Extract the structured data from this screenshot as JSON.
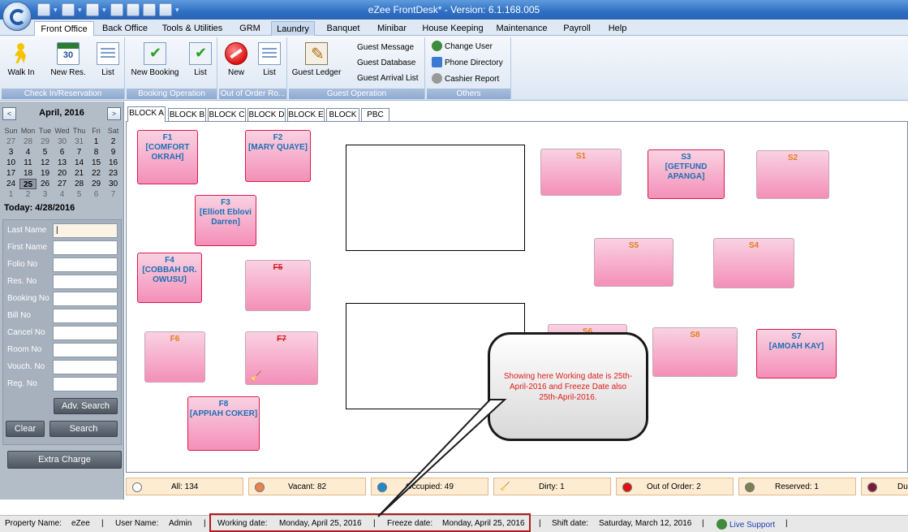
{
  "window": {
    "title": "eZee FrontDesk* - Version: 6.1.168.005"
  },
  "ribbon_tabs": [
    {
      "label": "Front Office"
    },
    {
      "label": "Back Office"
    },
    {
      "label": "Tools & Utilities"
    },
    {
      "label": "GRM"
    },
    {
      "label": "Laundry"
    },
    {
      "label": "Banquet"
    },
    {
      "label": "Minibar"
    },
    {
      "label": "House Keeping"
    },
    {
      "label": "Maintenance"
    },
    {
      "label": "Payroll"
    },
    {
      "label": "Help"
    }
  ],
  "ribbon": {
    "checkin": {
      "label": "Check In/Reservation",
      "walk_in": "Walk In",
      "new_res": "New Res.",
      "list": "List",
      "cal_day": "30"
    },
    "booking": {
      "label": "Booking Operation",
      "new_booking": "New Booking",
      "list": "List"
    },
    "ooo": {
      "label": "Out of Order Ro...",
      "new": "New",
      "list": "List"
    },
    "guest": {
      "label": "Guest Operation",
      "guest_ledger": "Guest Ledger",
      "guest_message": "Guest Message",
      "guest_database": "Guest Database",
      "guest_arrival_list": "Guest Arrival List"
    },
    "others": {
      "label": "Others",
      "change_user": "Change User",
      "phone_directory": "Phone Directory",
      "cashier_report": "Cashier Report"
    }
  },
  "calendar": {
    "prev": "<",
    "next": ">",
    "title": "April, 2016",
    "weekdays": [
      "Sun",
      "Mon",
      "Tue",
      "Wed",
      "Thu",
      "Fri",
      "Sat"
    ],
    "weeks": [
      [
        "27",
        "28",
        "29",
        "30",
        "31",
        "1",
        "2"
      ],
      [
        "3",
        "4",
        "5",
        "6",
        "7",
        "8",
        "9"
      ],
      [
        "10",
        "11",
        "12",
        "13",
        "14",
        "15",
        "16"
      ],
      [
        "17",
        "18",
        "19",
        "20",
        "21",
        "22",
        "23"
      ],
      [
        "24",
        "25",
        "26",
        "27",
        "28",
        "29",
        "30"
      ],
      [
        "1",
        "2",
        "3",
        "4",
        "5",
        "6",
        "7"
      ]
    ],
    "selected": "25",
    "today": "Today: 4/28/2016"
  },
  "search": {
    "fields": [
      {
        "label": "Last Name"
      },
      {
        "label": "First Name"
      },
      {
        "label": "Folio No"
      },
      {
        "label": "Res. No"
      },
      {
        "label": "Booking No"
      },
      {
        "label": "Bill No"
      },
      {
        "label": "Cancel No"
      },
      {
        "label": "Room No"
      },
      {
        "label": "Vouch. No"
      },
      {
        "label": "Reg. No"
      }
    ],
    "adv_search": "Adv. Search",
    "clear": "Clear",
    "search": "Search",
    "extra_charge": "Extra Charge"
  },
  "block_tabs": [
    "BLOCK A",
    "BLOCK B",
    "BLOCK C",
    "BLOCK D",
    "BLOCK E",
    "BLOCK F",
    "PBC"
  ],
  "rooms": [
    {
      "id": "F1",
      "guest": "[COMFORT OKRAH]",
      "status": "occupied"
    },
    {
      "id": "F2",
      "guest": "[MARY QUAYE]",
      "status": "occupied"
    },
    {
      "id": "F3",
      "guest": "[Elliott Eblovi Darren]",
      "status": "occupied"
    },
    {
      "id": "F4",
      "guest": "[COBBAH DR. OWUSU]",
      "status": "occupied"
    },
    {
      "id": "F5",
      "guest": "",
      "status": "out-of-order"
    },
    {
      "id": "F6",
      "guest": "",
      "status": "vacant"
    },
    {
      "id": "F7",
      "guest": "",
      "status": "out-of-order"
    },
    {
      "id": "F8",
      "guest": "[APPIAH COKER]",
      "status": "occupied"
    },
    {
      "id": "S1",
      "guest": "",
      "status": "vacant"
    },
    {
      "id": "S3",
      "guest": "[GETFUND APANGA]",
      "status": "occupied"
    },
    {
      "id": "S2",
      "guest": "",
      "status": "vacant"
    },
    {
      "id": "S5",
      "guest": "",
      "status": "vacant"
    },
    {
      "id": "S4",
      "guest": "",
      "status": "vacant"
    },
    {
      "id": "S6",
      "guest": "",
      "status": "vacant"
    },
    {
      "id": "S8",
      "guest": "",
      "status": "vacant"
    },
    {
      "id": "S7",
      "guest": "[AMOAH KAY]",
      "status": "occupied"
    }
  ],
  "callout": {
    "text": "Showing here Working date is 25th-April-2016 and Freeze Date also  25th-April-2016."
  },
  "legend": [
    {
      "label": "All: 134",
      "color": "#ffffff"
    },
    {
      "label": "Vacant: 82",
      "color": "#e8834a"
    },
    {
      "label": "Occupied: 49",
      "color": "#1e88c8"
    },
    {
      "label": "Dirty: 1",
      "color": ""
    },
    {
      "label": "Out of Order: 2",
      "color": "#e01010"
    },
    {
      "label": "Reserved: 1",
      "color": "#7a8050"
    },
    {
      "label": "Du",
      "color": "#7a1a3a"
    }
  ],
  "status": {
    "property_label": "Property Name:",
    "property_value": "eZee",
    "user_label": "User Name:",
    "user_value": "Admin",
    "working_label": "Working date:",
    "working_value": "Monday, April 25, 2016",
    "freeze_label": "Freeze date:",
    "freeze_value": "Monday, April 25, 2016",
    "shift_label": "Shift date:",
    "shift_value": "Saturday, March 12, 2016",
    "live_support": "Live Support",
    "sep": "|"
  }
}
